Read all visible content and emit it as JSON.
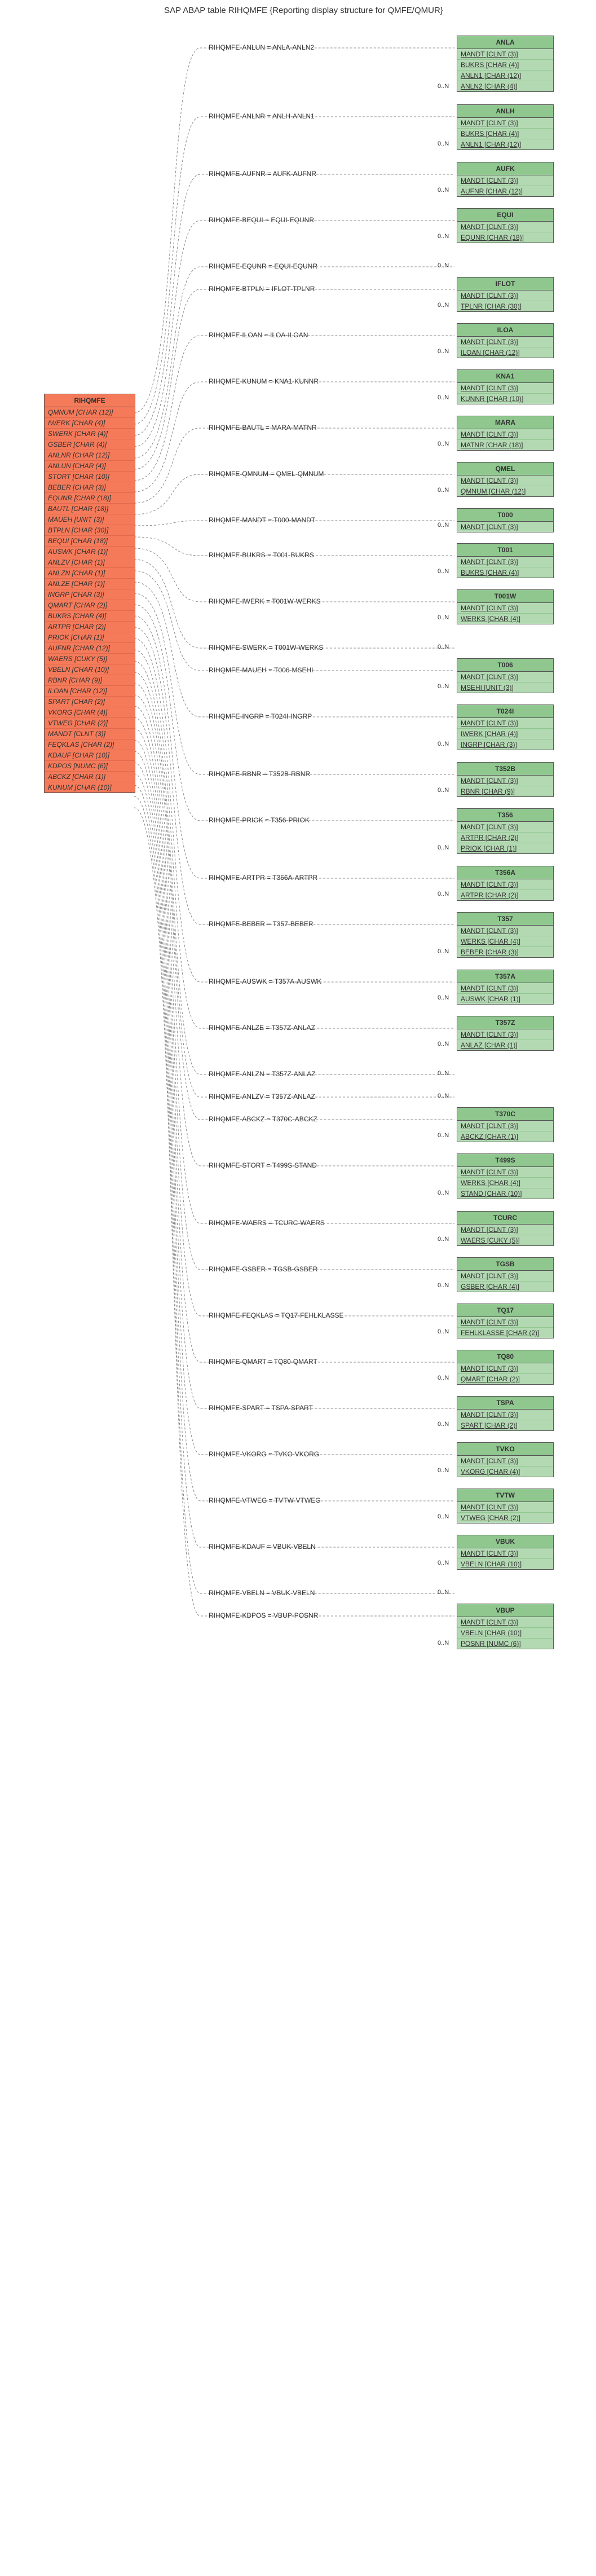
{
  "page_title": "SAP ABAP table RIHQMFE {Reporting display structure for QMFE/QMUR}",
  "main_table": {
    "name": "RIHQMFE",
    "fields": [
      "QMNUM [CHAR (12)]",
      "IWERK [CHAR (4)]",
      "SWERK [CHAR (4)]",
      "GSBER [CHAR (4)]",
      "ANLNR [CHAR (12)]",
      "ANLUN [CHAR (4)]",
      "STORT [CHAR (10)]",
      "BEBER [CHAR (3)]",
      "EQUNR [CHAR (18)]",
      "BAUTL [CHAR (18)]",
      "MAUEH [UNIT (3)]",
      "BTPLN [CHAR (30)]",
      "BEQUI [CHAR (18)]",
      "AUSWK [CHAR (1)]",
      "ANLZV [CHAR (1)]",
      "ANLZN [CHAR (1)]",
      "ANLZE [CHAR (1)]",
      "INGRP [CHAR (3)]",
      "QMART [CHAR (2)]",
      "BUKRS [CHAR (4)]",
      "ARTPR [CHAR (2)]",
      "PRIOK [CHAR (1)]",
      "AUFNR [CHAR (12)]",
      "WAERS [CUKY (5)]",
      "VBELN [CHAR (10)]",
      "RBNR [CHAR (9)]",
      "ILOAN [CHAR (12)]",
      "SPART [CHAR (2)]",
      "VKORG [CHAR (4)]",
      "VTWEG [CHAR (2)]",
      "MANDT [CLNT (3)]",
      "FEQKLAS [CHAR (2)]",
      "KDAUF [CHAR (10)]",
      "KDPOS [NUMC (6)]",
      "ABCKZ [CHAR (1)]",
      "KUNUM [CHAR (10)]"
    ]
  },
  "relations": [
    {
      "label": "RIHQMFE-ANLUN = ANLA-ANLN2",
      "card": "0..N",
      "table": "ANLA",
      "rows": [
        "MANDT [CLNT (3)]",
        "BUKRS [CHAR (4)]",
        "ANLN1 [CHAR (12)]",
        "ANLN2 [CHAR (4)]"
      ],
      "keycount": 4
    },
    {
      "label": "RIHQMFE-ANLNR = ANLH-ANLN1",
      "card": "0..N",
      "table": "ANLH",
      "rows": [
        "MANDT [CLNT (3)]",
        "BUKRS [CHAR (4)]",
        "ANLN1 [CHAR (12)]"
      ],
      "keycount": 3
    },
    {
      "label": "RIHQMFE-AUFNR = AUFK-AUFNR",
      "card": "0..N",
      "table": "AUFK",
      "rows": [
        "MANDT [CLNT (3)]",
        "AUFNR [CHAR (12)]"
      ],
      "keycount": 2
    },
    {
      "label": "RIHQMFE-BEQUI = EQUI-EQUNR",
      "card": "0..N",
      "table": "EQUI",
      "rows": [
        "MANDT [CLNT (3)]",
        "EQUNR [CHAR (18)]"
      ],
      "keycount": 2
    },
    {
      "label": "RIHQMFE-EQUNR = EQUI-EQUNR",
      "card": "0..N",
      "table": "EQUI",
      "rows": [
        "..."
      ],
      "keycount": 0,
      "hideTable": true
    },
    {
      "label": "RIHQMFE-BTPLN = IFLOT-TPLNR",
      "card": "0..N",
      "table": "IFLOT",
      "rows": [
        "MANDT [CLNT (3)]",
        "TPLNR [CHAR (30)]"
      ],
      "keycount": 2
    },
    {
      "label": "RIHQMFE-ILOAN = ILOA-ILOAN",
      "card": "0..N",
      "table": "ILOA",
      "rows": [
        "MANDT [CLNT (3)]",
        "ILOAN [CHAR (12)]"
      ],
      "keycount": 2
    },
    {
      "label": "RIHQMFE-KUNUM = KNA1-KUNNR",
      "card": "0..N",
      "table": "KNA1",
      "rows": [
        "MANDT [CLNT (3)]",
        "KUNNR [CHAR (10)]"
      ],
      "keycount": 2
    },
    {
      "label": "RIHQMFE-BAUTL = MARA-MATNR",
      "card": "0..N",
      "table": "MARA",
      "rows": [
        "MANDT [CLNT (3)]",
        "MATNR [CHAR (18)]"
      ],
      "keycount": 2
    },
    {
      "label": "RIHQMFE-QMNUM = QMEL-QMNUM",
      "card": "0..N",
      "table": "QMEL",
      "rows": [
        "MANDT [CLNT (3)]",
        "QMNUM [CHAR (12)]"
      ],
      "keycount": 2
    },
    {
      "label": "RIHQMFE-MANDT = T000-MANDT",
      "card": "0..N",
      "table": "T000",
      "rows": [
        "MANDT [CLNT (3)]"
      ],
      "keycount": 1
    },
    {
      "label": "RIHQMFE-BUKRS = T001-BUKRS",
      "card": "0..N",
      "table": "T001",
      "rows": [
        "MANDT [CLNT (3)]",
        "BUKRS [CHAR (4)]"
      ],
      "keycount": 2
    },
    {
      "label": "RIHQMFE-IWERK = T001W-WERKS",
      "card": "0..N",
      "table": "T001W",
      "rows": [
        "MANDT [CLNT (3)]",
        "WERKS [CHAR (4)]"
      ],
      "keycount": 2
    },
    {
      "label": "RIHQMFE-SWERK = T001W-WERKS",
      "card": "0..N",
      "table": "T001W",
      "rows": [
        "..."
      ],
      "keycount": 0,
      "hideTable": true
    },
    {
      "label": "RIHQMFE-MAUEH = T006-MSEHI",
      "card": "0..N",
      "table": "T006",
      "rows": [
        "MANDT [CLNT (3)]",
        "MSEHI [UNIT (3)]"
      ],
      "keycount": 2
    },
    {
      "label": "RIHQMFE-INGRP = T024I-INGRP",
      "card": "0..N",
      "table": "T024I",
      "rows": [
        "MANDT [CLNT (3)]",
        "IWERK [CHAR (4)]",
        "INGRP [CHAR (3)]"
      ],
      "keycount": 3
    },
    {
      "label": "RIHQMFE-RBNR = T352B-RBNR",
      "card": "0..N",
      "table": "T352B",
      "rows": [
        "MANDT [CLNT (3)]",
        "RBNR [CHAR (9)]"
      ],
      "keycount": 2
    },
    {
      "label": "RIHQMFE-PRIOK = T356-PRIOK",
      "card": "0..N",
      "table": "T356",
      "rows": [
        "MANDT [CLNT (3)]",
        "ARTPR [CHAR (2)]",
        "PRIOK [CHAR (1)]"
      ],
      "keycount": 3
    },
    {
      "label": "RIHQMFE-ARTPR = T356A-ARTPR",
      "card": "0..N",
      "table": "T356A",
      "rows": [
        "MANDT [CLNT (3)]",
        "ARTPR [CHAR (2)]"
      ],
      "keycount": 2
    },
    {
      "label": "RIHQMFE-BEBER = T357-BEBER",
      "card": "0..N",
      "table": "T357",
      "rows": [
        "MANDT [CLNT (3)]",
        "WERKS [CHAR (4)]",
        "BEBER [CHAR (3)]"
      ],
      "keycount": 3
    },
    {
      "label": "RIHQMFE-AUSWK = T357A-AUSWK",
      "card": "0..N",
      "table": "T357A",
      "rows": [
        "MANDT [CLNT (3)]",
        "AUSWK [CHAR (1)]"
      ],
      "keycount": 2
    },
    {
      "label": "RIHQMFE-ANLZE = T357Z-ANLAZ",
      "card": "0..N",
      "table": "T357Z",
      "rows": [
        "MANDT [CLNT (3)]",
        "ANLAZ [CHAR (1)]"
      ],
      "keycount": 2
    },
    {
      "label": "RIHQMFE-ANLZN = T357Z-ANLAZ",
      "card": "0..N",
      "table": "T357Z",
      "rows": [
        "..."
      ],
      "keycount": 0,
      "hideTable": true
    },
    {
      "label": "RIHQMFE-ANLZV = T357Z-ANLAZ",
      "card": "0..N",
      "table": "T357Z",
      "rows": [
        "..."
      ],
      "keycount": 0,
      "hideTable": true
    },
    {
      "label": "RIHQMFE-ABCKZ = T370C-ABCKZ",
      "card": "0..N",
      "table": "T370C",
      "rows": [
        "MANDT [CLNT (3)]",
        "ABCKZ [CHAR (1)]"
      ],
      "keycount": 2
    },
    {
      "label": "RIHQMFE-STORT = T499S-STAND",
      "card": "0..N",
      "table": "T499S",
      "rows": [
        "MANDT [CLNT (3)]",
        "WERKS [CHAR (4)]",
        "STAND [CHAR (10)]"
      ],
      "keycount": 3
    },
    {
      "label": "RIHQMFE-WAERS = TCURC-WAERS",
      "card": "0..N",
      "table": "TCURC",
      "rows": [
        "MANDT [CLNT (3)]",
        "WAERS [CUKY (5)]"
      ],
      "keycount": 2
    },
    {
      "label": "RIHQMFE-GSBER = TGSB-GSBER",
      "card": "0..N",
      "table": "TGSB",
      "rows": [
        "MANDT [CLNT (3)]",
        "GSBER [CHAR (4)]"
      ],
      "keycount": 2
    },
    {
      "label": "RIHQMFE-FEQKLAS = TQ17-FEHLKLASSE",
      "card": "0..N",
      "table": "TQ17",
      "rows": [
        "MANDT [CLNT (3)]",
        "FEHLKLASSE [CHAR (2)]"
      ],
      "keycount": 2
    },
    {
      "label": "RIHQMFE-QMART = TQ80-QMART",
      "card": "0..N",
      "table": "TQ80",
      "rows": [
        "MANDT [CLNT (3)]",
        "QMART [CHAR (2)]"
      ],
      "keycount": 2
    },
    {
      "label": "RIHQMFE-SPART = TSPA-SPART",
      "card": "0..N",
      "table": "TSPA",
      "rows": [
        "MANDT [CLNT (3)]",
        "SPART [CHAR (2)]"
      ],
      "keycount": 2
    },
    {
      "label": "RIHQMFE-VKORG = TVKO-VKORG",
      "card": "0..N",
      "table": "TVKO",
      "rows": [
        "MANDT [CLNT (3)]",
        "VKORG [CHAR (4)]"
      ],
      "keycount": 2
    },
    {
      "label": "RIHQMFE-VTWEG = TVTW-VTWEG",
      "card": "0..N",
      "table": "TVTW",
      "rows": [
        "MANDT [CLNT (3)]",
        "VTWEG [CHAR (2)]"
      ],
      "keycount": 2
    },
    {
      "label": "RIHQMFE-KDAUF = VBUK-VBELN",
      "card": "0..N",
      "table": "VBUK",
      "rows": [
        "MANDT [CLNT (3)]",
        "VBELN [CHAR (10)]"
      ],
      "keycount": 2
    },
    {
      "label": "RIHQMFE-VBELN = VBUK-VBELN",
      "card": "0..N",
      "table": "VBUK",
      "rows": [
        "..."
      ],
      "keycount": 0,
      "hideTable": true
    },
    {
      "label": "RIHQMFE-KDPOS = VBUP-POSNR",
      "card": "0..N",
      "table": "VBUP",
      "rows": [
        "MANDT [CLNT (3)]",
        "VBELN [CHAR (10)]",
        "POSNR [NUMC (6)]"
      ],
      "keycount": 3
    }
  ],
  "chart_data": {
    "type": "table",
    "title": "SAP ABAP table RIHQMFE foreign-key relationships to reference tables",
    "relationships": [
      {
        "from": "RIHQMFE.ANLUN",
        "to": "ANLA.ANLN2",
        "card": "0..N"
      },
      {
        "from": "RIHQMFE.ANLNR",
        "to": "ANLH.ANLN1",
        "card": "0..N"
      },
      {
        "from": "RIHQMFE.AUFNR",
        "to": "AUFK.AUFNR",
        "card": "0..N"
      },
      {
        "from": "RIHQMFE.BEQUI",
        "to": "EQUI.EQUNR",
        "card": "0..N"
      },
      {
        "from": "RIHQMFE.EQUNR",
        "to": "EQUI.EQUNR",
        "card": "0..N"
      },
      {
        "from": "RIHQMFE.BTPLN",
        "to": "IFLOT.TPLNR",
        "card": "0..N"
      },
      {
        "from": "RIHQMFE.ILOAN",
        "to": "ILOA.ILOAN",
        "card": "0..N"
      },
      {
        "from": "RIHQMFE.KUNUM",
        "to": "KNA1.KUNNR",
        "card": "0..N"
      },
      {
        "from": "RIHQMFE.BAUTL",
        "to": "MARA.MATNR",
        "card": "0..N"
      },
      {
        "from": "RIHQMFE.QMNUM",
        "to": "QMEL.QMNUM",
        "card": "0..N"
      },
      {
        "from": "RIHQMFE.MANDT",
        "to": "T000.MANDT",
        "card": "0..N"
      },
      {
        "from": "RIHQMFE.BUKRS",
        "to": "T001.BUKRS",
        "card": "0..N"
      },
      {
        "from": "RIHQMFE.IWERK",
        "to": "T001W.WERKS",
        "card": "0..N"
      },
      {
        "from": "RIHQMFE.SWERK",
        "to": "T001W.WERKS",
        "card": "0..N"
      },
      {
        "from": "RIHQMFE.MAUEH",
        "to": "T006.MSEHI",
        "card": "0..N"
      },
      {
        "from": "RIHQMFE.INGRP",
        "to": "T024I.INGRP",
        "card": "0..N"
      },
      {
        "from": "RIHQMFE.RBNR",
        "to": "T352B.RBNR",
        "card": "0..N"
      },
      {
        "from": "RIHQMFE.PRIOK",
        "to": "T356.PRIOK",
        "card": "0..N"
      },
      {
        "from": "RIHQMFE.ARTPR",
        "to": "T356A.ARTPR",
        "card": "0..N"
      },
      {
        "from": "RIHQMFE.BEBER",
        "to": "T357.BEBER",
        "card": "0..N"
      },
      {
        "from": "RIHQMFE.AUSWK",
        "to": "T357A.AUSWK",
        "card": "0..N"
      },
      {
        "from": "RIHQMFE.ANLZE",
        "to": "T357Z.ANLAZ",
        "card": "0..N"
      },
      {
        "from": "RIHQMFE.ANLZN",
        "to": "T357Z.ANLAZ",
        "card": "0..N"
      },
      {
        "from": "RIHQMFE.ANLZV",
        "to": "T357Z.ANLAZ",
        "card": "0..N"
      },
      {
        "from": "RIHQMFE.ABCKZ",
        "to": "T370C.ABCKZ",
        "card": "0..N"
      },
      {
        "from": "RIHQMFE.STORT",
        "to": "T499S.STAND",
        "card": "0..N"
      },
      {
        "from": "RIHQMFE.WAERS",
        "to": "TCURC.WAERS",
        "card": "0..N"
      },
      {
        "from": "RIHQMFE.GSBER",
        "to": "TGSB.GSBER",
        "card": "0..N"
      },
      {
        "from": "RIHQMFE.FEQKLAS",
        "to": "TQ17.FEHLKLASSE",
        "card": "0..N"
      },
      {
        "from": "RIHQMFE.QMART",
        "to": "TQ80.QMART",
        "card": "0..N"
      },
      {
        "from": "RIHQMFE.SPART",
        "to": "TSPA.SPART",
        "card": "0..N"
      },
      {
        "from": "RIHQMFE.VKORG",
        "to": "TVKO.VKORG",
        "card": "0..N"
      },
      {
        "from": "RIHQMFE.VTWEG",
        "to": "TVTW.VTWEG",
        "card": "0..N"
      },
      {
        "from": "RIHQMFE.KDAUF",
        "to": "VBUK.VBELN",
        "card": "0..N"
      },
      {
        "from": "RIHQMFE.VBELN",
        "to": "VBUK.VBELN",
        "card": "0..N"
      },
      {
        "from": "RIHQMFE.KDPOS",
        "to": "VBUP.POSNR",
        "card": "0..N"
      }
    ]
  }
}
